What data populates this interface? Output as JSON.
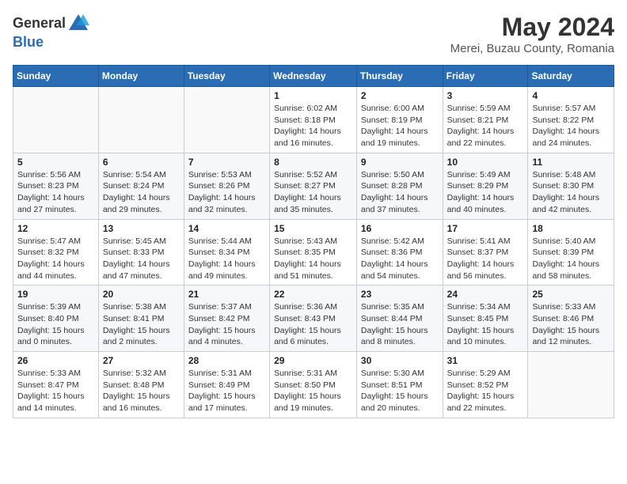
{
  "logo": {
    "general": "General",
    "blue": "Blue"
  },
  "title": "May 2024",
  "location": "Merei, Buzau County, Romania",
  "weekdays": [
    "Sunday",
    "Monday",
    "Tuesday",
    "Wednesday",
    "Thursday",
    "Friday",
    "Saturday"
  ],
  "weeks": [
    [
      {
        "day": "",
        "info": ""
      },
      {
        "day": "",
        "info": ""
      },
      {
        "day": "",
        "info": ""
      },
      {
        "day": "1",
        "info": "Sunrise: 6:02 AM\nSunset: 8:18 PM\nDaylight: 14 hours and 16 minutes."
      },
      {
        "day": "2",
        "info": "Sunrise: 6:00 AM\nSunset: 8:19 PM\nDaylight: 14 hours and 19 minutes."
      },
      {
        "day": "3",
        "info": "Sunrise: 5:59 AM\nSunset: 8:21 PM\nDaylight: 14 hours and 22 minutes."
      },
      {
        "day": "4",
        "info": "Sunrise: 5:57 AM\nSunset: 8:22 PM\nDaylight: 14 hours and 24 minutes."
      }
    ],
    [
      {
        "day": "5",
        "info": "Sunrise: 5:56 AM\nSunset: 8:23 PM\nDaylight: 14 hours and 27 minutes."
      },
      {
        "day": "6",
        "info": "Sunrise: 5:54 AM\nSunset: 8:24 PM\nDaylight: 14 hours and 29 minutes."
      },
      {
        "day": "7",
        "info": "Sunrise: 5:53 AM\nSunset: 8:26 PM\nDaylight: 14 hours and 32 minutes."
      },
      {
        "day": "8",
        "info": "Sunrise: 5:52 AM\nSunset: 8:27 PM\nDaylight: 14 hours and 35 minutes."
      },
      {
        "day": "9",
        "info": "Sunrise: 5:50 AM\nSunset: 8:28 PM\nDaylight: 14 hours and 37 minutes."
      },
      {
        "day": "10",
        "info": "Sunrise: 5:49 AM\nSunset: 8:29 PM\nDaylight: 14 hours and 40 minutes."
      },
      {
        "day": "11",
        "info": "Sunrise: 5:48 AM\nSunset: 8:30 PM\nDaylight: 14 hours and 42 minutes."
      }
    ],
    [
      {
        "day": "12",
        "info": "Sunrise: 5:47 AM\nSunset: 8:32 PM\nDaylight: 14 hours and 44 minutes."
      },
      {
        "day": "13",
        "info": "Sunrise: 5:45 AM\nSunset: 8:33 PM\nDaylight: 14 hours and 47 minutes."
      },
      {
        "day": "14",
        "info": "Sunrise: 5:44 AM\nSunset: 8:34 PM\nDaylight: 14 hours and 49 minutes."
      },
      {
        "day": "15",
        "info": "Sunrise: 5:43 AM\nSunset: 8:35 PM\nDaylight: 14 hours and 51 minutes."
      },
      {
        "day": "16",
        "info": "Sunrise: 5:42 AM\nSunset: 8:36 PM\nDaylight: 14 hours and 54 minutes."
      },
      {
        "day": "17",
        "info": "Sunrise: 5:41 AM\nSunset: 8:37 PM\nDaylight: 14 hours and 56 minutes."
      },
      {
        "day": "18",
        "info": "Sunrise: 5:40 AM\nSunset: 8:39 PM\nDaylight: 14 hours and 58 minutes."
      }
    ],
    [
      {
        "day": "19",
        "info": "Sunrise: 5:39 AM\nSunset: 8:40 PM\nDaylight: 15 hours and 0 minutes."
      },
      {
        "day": "20",
        "info": "Sunrise: 5:38 AM\nSunset: 8:41 PM\nDaylight: 15 hours and 2 minutes."
      },
      {
        "day": "21",
        "info": "Sunrise: 5:37 AM\nSunset: 8:42 PM\nDaylight: 15 hours and 4 minutes."
      },
      {
        "day": "22",
        "info": "Sunrise: 5:36 AM\nSunset: 8:43 PM\nDaylight: 15 hours and 6 minutes."
      },
      {
        "day": "23",
        "info": "Sunrise: 5:35 AM\nSunset: 8:44 PM\nDaylight: 15 hours and 8 minutes."
      },
      {
        "day": "24",
        "info": "Sunrise: 5:34 AM\nSunset: 8:45 PM\nDaylight: 15 hours and 10 minutes."
      },
      {
        "day": "25",
        "info": "Sunrise: 5:33 AM\nSunset: 8:46 PM\nDaylight: 15 hours and 12 minutes."
      }
    ],
    [
      {
        "day": "26",
        "info": "Sunrise: 5:33 AM\nSunset: 8:47 PM\nDaylight: 15 hours and 14 minutes."
      },
      {
        "day": "27",
        "info": "Sunrise: 5:32 AM\nSunset: 8:48 PM\nDaylight: 15 hours and 16 minutes."
      },
      {
        "day": "28",
        "info": "Sunrise: 5:31 AM\nSunset: 8:49 PM\nDaylight: 15 hours and 17 minutes."
      },
      {
        "day": "29",
        "info": "Sunrise: 5:31 AM\nSunset: 8:50 PM\nDaylight: 15 hours and 19 minutes."
      },
      {
        "day": "30",
        "info": "Sunrise: 5:30 AM\nSunset: 8:51 PM\nDaylight: 15 hours and 20 minutes."
      },
      {
        "day": "31",
        "info": "Sunrise: 5:29 AM\nSunset: 8:52 PM\nDaylight: 15 hours and 22 minutes."
      },
      {
        "day": "",
        "info": ""
      }
    ]
  ]
}
